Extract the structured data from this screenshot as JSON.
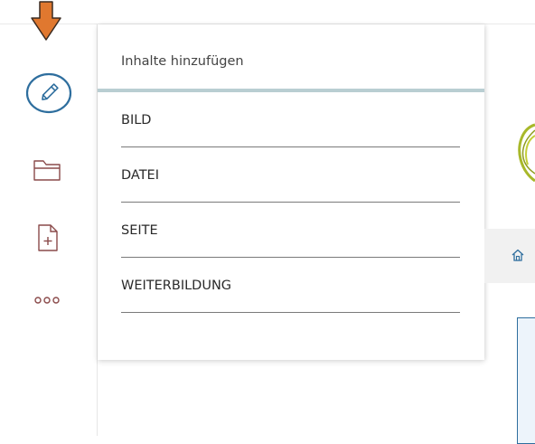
{
  "panel": {
    "title": "Inhalte hinzufügen",
    "items": [
      {
        "label": "BILD"
      },
      {
        "label": "DATEI"
      },
      {
        "label": "SEITE"
      },
      {
        "label": "WEITERBILDUNG"
      }
    ]
  },
  "sidebar": {
    "icons": [
      "pencil-icon",
      "folder-icon",
      "add-document-icon",
      "more-icon"
    ]
  },
  "colors": {
    "accent": "#2e6e9e",
    "arrow": "#e0782f",
    "header_rule": "#b9ced2",
    "icon_brown": "#8a4a4a",
    "logo_green": "#a8b82a"
  }
}
